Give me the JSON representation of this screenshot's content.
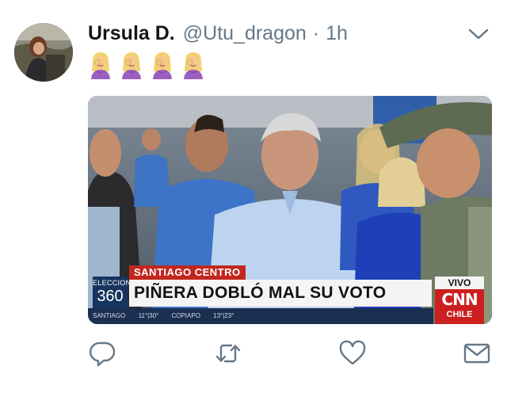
{
  "tweet": {
    "display_name": "Ursula D.",
    "handle": "@Utu_dragon",
    "separator": "·",
    "time": "1h",
    "emoji_count": 4,
    "emoji_name": "woman-facepalming-emoji",
    "colors": {
      "text": "#14171a",
      "muted": "#657786",
      "icon": "#657786"
    }
  },
  "media": {
    "location_tag": "SANTIAGO CENTRO",
    "program_line1": "ELECCION",
    "program_line2": "360",
    "headline": "PIÑERA DOBLÓ MAL SU VOTO",
    "live_label": "VIVO",
    "network_logo": "CNN",
    "network_country": "CHILE",
    "ticker": "SANTIAGO 11°|30° COPIAPO 13°|23°",
    "colors": {
      "banner_red": "#c1271e",
      "banner_navy": "#16345e",
      "cnn_red": "#cc1f1f"
    }
  },
  "actions": {
    "reply": "reply-icon",
    "retweet": "retweet-icon",
    "like": "like-icon",
    "message": "message-icon"
  }
}
